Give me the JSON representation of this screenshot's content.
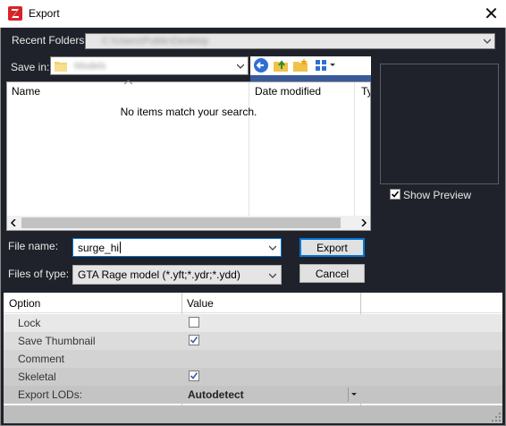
{
  "window": {
    "title": "Export",
    "close_glyph": "✕"
  },
  "recent_folders": {
    "label": "Recent Folders:",
    "value": "C:\\Users\\Public\\Desktop"
  },
  "save_in": {
    "label": "Save in:",
    "value": "Models"
  },
  "file_list": {
    "columns": [
      "Name",
      "Date modified",
      "Ty"
    ],
    "empty_message": "No items match your search."
  },
  "preview": {
    "show_label": "Show Preview",
    "checked": true
  },
  "file_name": {
    "label": "File name:",
    "value": "surge_hi"
  },
  "file_type": {
    "label": "Files of type:",
    "value": "GTA Rage model (*.yft;*.ydr;*.ydd)"
  },
  "buttons": {
    "export": "Export",
    "cancel": "Cancel"
  },
  "options": {
    "headers": [
      "Option",
      "Value"
    ],
    "rows": [
      {
        "name": "Lock",
        "checked": false
      },
      {
        "name": "Save Thumbnail",
        "checked": true
      },
      {
        "name": "Comment",
        "value": ""
      },
      {
        "name": "Skeletal",
        "checked": true
      },
      {
        "name": "Export LODs:",
        "value": "Autodetect"
      }
    ]
  },
  "colors": {
    "accent": "#0078d7",
    "dialog_bg": "#20222b"
  }
}
